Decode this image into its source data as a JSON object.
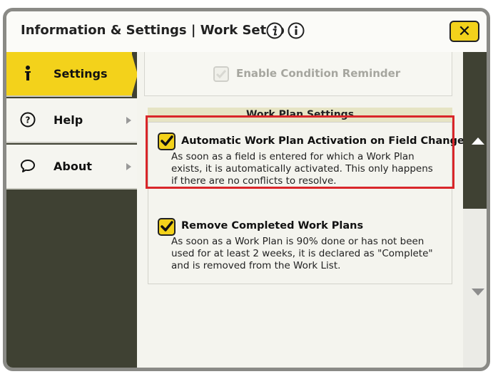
{
  "header": {
    "title": "Information & Settings | Work Setup",
    "close_label": "✕"
  },
  "sidebar": {
    "items": [
      {
        "label": "Settings",
        "icon": "person-icon",
        "selected": true
      },
      {
        "label": "Help",
        "icon": "question-icon",
        "selected": false
      },
      {
        "label": "About",
        "icon": "speech-bubble-icon",
        "selected": false
      }
    ]
  },
  "content": {
    "enable_condition_reminder": {
      "label": "Enable Condition Reminder",
      "checked": false,
      "disabled": true
    },
    "section_title": "Work Plan Settings",
    "options": [
      {
        "title": "Automatic Work Plan Activation on Field Change",
        "description_lines": [
          "As soon as a field is entered for which a Work Plan",
          "exists, it is automatically activated. This only happens",
          "if there are no conflicts to resolve."
        ],
        "checked": true
      },
      {
        "title": "Remove Completed Work Plans",
        "description_lines": [
          "As soon as a Work Plan is 90% done or has not been",
          "used for at least 2 weeks, it is declared as \"Complete\"",
          "and is removed from the Work List."
        ],
        "checked": true
      }
    ]
  },
  "colors": {
    "accent_yellow": "#f3d21b",
    "dark_panel": "#3f4133",
    "highlight_red": "#d9262a"
  }
}
